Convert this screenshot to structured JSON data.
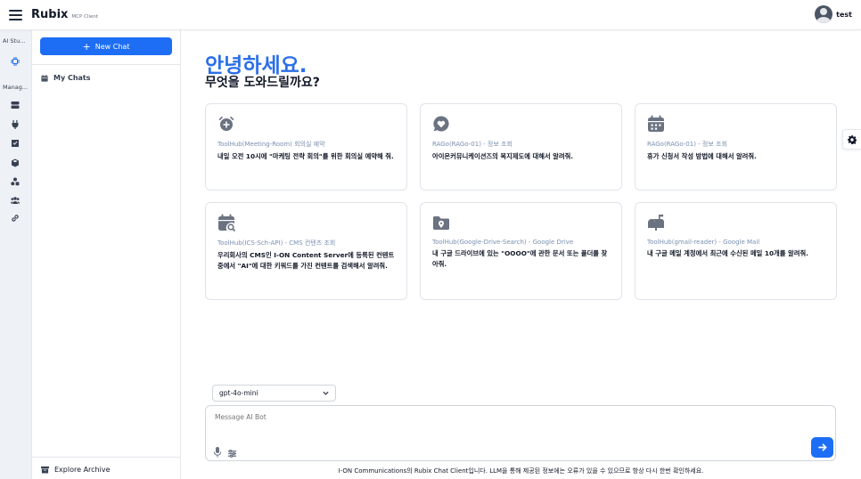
{
  "header": {
    "brand_name": "Rubix",
    "brand_sub": "MCP Client",
    "user_name": "test"
  },
  "rail": {
    "section_ai": "AI Stu...",
    "section_manage": "Manag...",
    "icons": [
      "chip-icon",
      "server-icon",
      "plug-icon",
      "checkbox-icon",
      "cube-icon",
      "shapes-icon",
      "users-icon",
      "link-icon"
    ]
  },
  "sidebar": {
    "new_chat_label": "New Chat",
    "my_chats_label": "My Chats",
    "archive_label": "Explore Archive"
  },
  "main": {
    "greeting_title": "안녕하세요.",
    "greeting_sub": "무엇을 도와드릴까요?",
    "cards": [
      {
        "icon": "alarm-icon",
        "tag": "ToolHub(Meeting-Room) 회의실 예약",
        "text": "내일 오전 10시에 \"마케팅 전략 회의\"를 위한 회의실 예약해 줘."
      },
      {
        "icon": "heart-chat-icon",
        "tag": "RAGo(RAGo-01) - 정보 조회",
        "text": "아이온커뮤니케이션즈의 복지제도에 대해서 알려줘."
      },
      {
        "icon": "calendar-icon",
        "tag": "RAGo(RAGo-01) - 정보 조회",
        "text": "휴가 신청서 작성 방법에 대해서 알려줘."
      },
      {
        "icon": "calendar-search-icon",
        "tag": "ToolHub(ICS-Sch-API) - CMS 컨텐츠 조회",
        "text": "우리회사의 CMS인 I-ON Content Server에 등록된 컨텐트 중에서 \"AI\"에 대한 키워드를 가진 컨텐트를 검색해서 알려줘."
      },
      {
        "icon": "folder-pin-icon",
        "tag": "ToolHub(Google-Drive-Search) - Google Drive",
        "text": "내 구글 드라이브에 있는 \"OOOO\"에 관한 문서 또는 폴더를 찾아줘."
      },
      {
        "icon": "mailbox-icon",
        "tag": "ToolHub(gmail-reader) - Google Mail",
        "text": "내 구글 메일 계정에서 최근에 수신된 메일 10개를 알려줘."
      }
    ],
    "model_selected": "gpt-4o-mini",
    "composer_placeholder": "Message AI Bot",
    "footer_note": "I-ON Communications의 Rubix Chat Client입니다. LLM을 통해 제공된 정보에는 오류가 있을 수 있으므로 항상 다시 한번 확인하세요."
  },
  "colors": {
    "accent": "#1d6ef5",
    "greeting": "#2b6fe8",
    "tag": "#7a8fb0"
  }
}
